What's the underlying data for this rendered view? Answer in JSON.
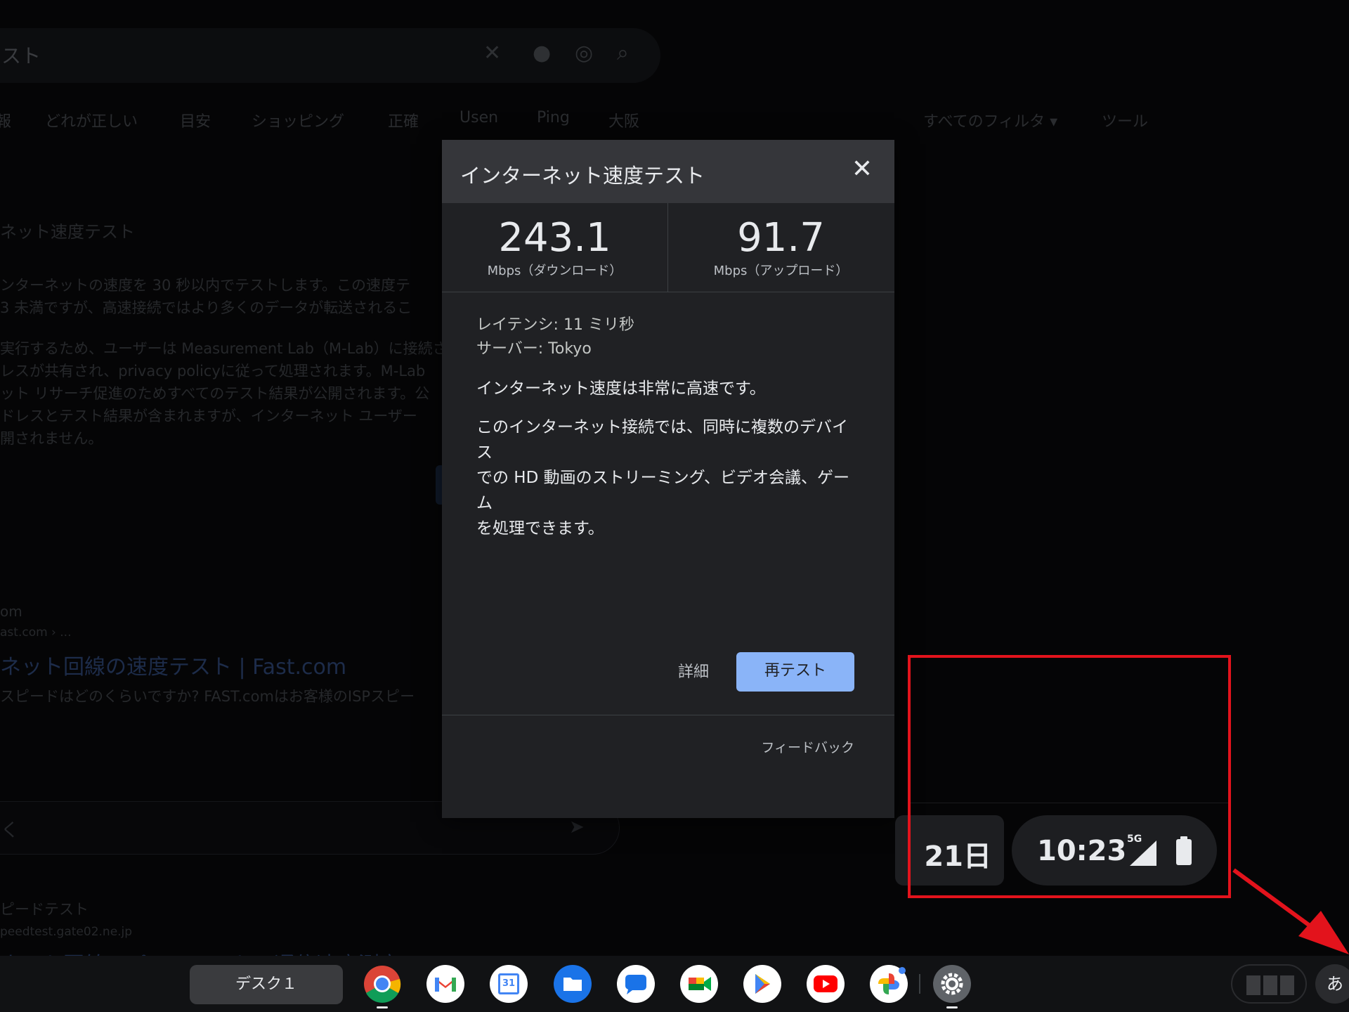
{
  "background": {
    "search_query": "スト",
    "filter_chips": [
      "報",
      "どれが正しい",
      "目安",
      "ショッピング",
      "正確",
      "Usen",
      "Ping",
      "大阪"
    ],
    "all_filters": "すべてのフィルタ ▾",
    "tools": "ツール",
    "section_title": "ネット速度テスト",
    "desc_lines": [
      "ンターネットの速度を 30 秒以内でテストします。この速度テ",
      "3 未満ですが、高速接続ではより多くのデータが転送されるこ",
      "実行するため、ユーザーは Measurement Lab（M-Lab）に接続さ",
      "レスが共有され、privacy policyに従って処理されます。M-Lab",
      "ット リサーチ促進のためすべてのテスト結果が公開されます。公",
      "ドレスとテスト結果が含まれますが、インターネット ユーザー",
      "開されません。"
    ],
    "result1_site": "om",
    "result1_url": "ast.com › ...",
    "result1_title": "ネット回線の速度テスト | Fast.com",
    "result1_snippet": "スピードはどのくらいですか? FAST.comはお客様のISPスピー",
    "input_placeholder": "く",
    "result2_site": "ピードテスト",
    "result2_url": "peedtest.gate02.ne.jp",
    "result2_title": "ネット回線スピードテスト - 通信速度測定 | USEN"
  },
  "dialog": {
    "title": "インターネット速度テスト",
    "close_symbol": "✕",
    "download_value": "243.1",
    "download_unit": "Mbps（ダウンロード）",
    "upload_value": "91.7",
    "upload_unit": "Mbps（アップロード）",
    "latency": "レイテンシ: 11 ミリ秒",
    "server": "サーバー: Tokyo",
    "summary": "インターネット速度は非常に高速です。",
    "description_lines": [
      "このインターネット接続では、同時に複数のデバイス",
      "での HD 動画のストリーミング、ビデオ会議、ゲーム",
      "を処理できます。"
    ],
    "details_label": "詳細",
    "retest_label": "再テスト",
    "feedback_label": "フィードバック"
  },
  "status_area": {
    "date_fragment": "21日",
    "time": "10:23",
    "network": "5G"
  },
  "shelf": {
    "desk_label": "デスク１",
    "apps": [
      "chrome-icon",
      "gmail-icon",
      "calendar-icon",
      "files-icon",
      "messages-icon",
      "meet-icon",
      "play-store-icon",
      "youtube-icon",
      "photos-icon",
      "settings-icon"
    ],
    "calendar_day": "31",
    "ime_label": "あ"
  },
  "colors": {
    "highlight": "#e3131c",
    "retest_button": "#8ab4f8",
    "dialog_bg": "#202124"
  }
}
